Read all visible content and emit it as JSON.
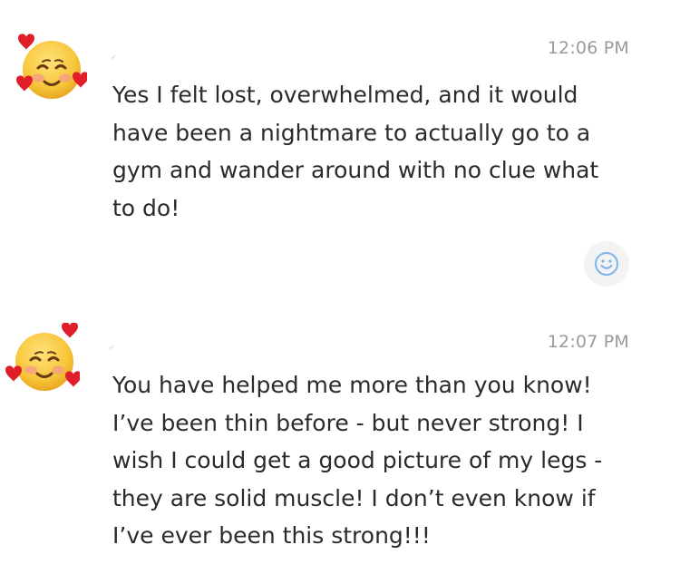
{
  "icons": {
    "avatar": "smiling-face-with-hearts-icon",
    "reaction": "smiley-face-icon"
  },
  "colors": {
    "reaction_icon": "#7fb4ec",
    "timestamp": "#9a9a9a",
    "text": "#2b2b2b",
    "heart": "#e01e2a",
    "emoji_face": "#f7c63a"
  },
  "messages": [
    {
      "time": "12:06 PM",
      "text": "Yes I felt lost, overwhelmed, and it would\nhave been a nightmare to actually go to a\ngym and wander around with no clue what\nto do!"
    },
    {
      "time": "12:07 PM",
      "text": "You have helped me more than you know!\nI’ve been thin before - but never strong!  I\nwish I could get a good picture of my legs -\nthey are solid muscle!  I don’t even know if\nI’ve ever been this strong!!!"
    }
  ]
}
